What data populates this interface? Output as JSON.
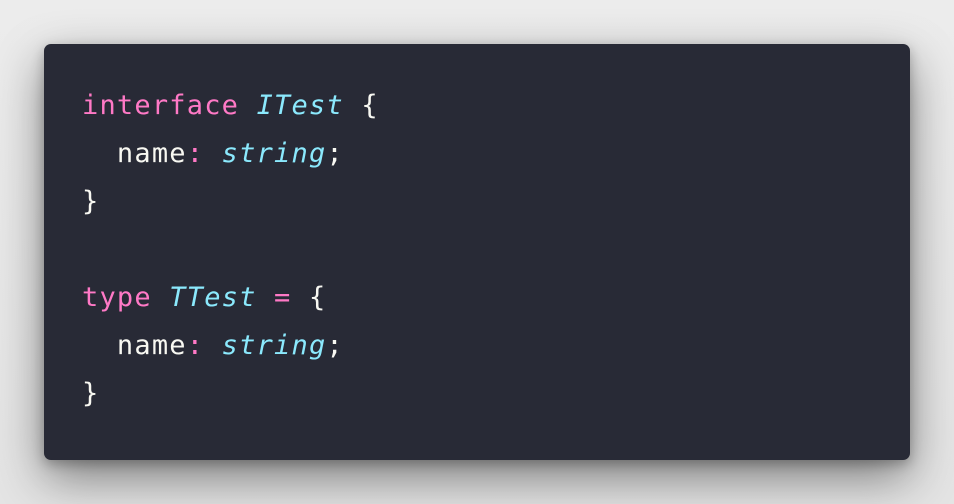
{
  "colors": {
    "background": "#282a36",
    "foreground": "#f8f8f2",
    "keyword": "#ff79c6",
    "type": "#8be9fd"
  },
  "code": {
    "lines": [
      [
        {
          "text": "interface",
          "role": "kw"
        },
        {
          "text": " ",
          "role": "punct"
        },
        {
          "text": "ITest",
          "role": "type"
        },
        {
          "text": " {",
          "role": "punct"
        }
      ],
      [
        {
          "text": "  name",
          "role": "ident"
        },
        {
          "text": ":",
          "role": "op"
        },
        {
          "text": " ",
          "role": "punct"
        },
        {
          "text": "string",
          "role": "type"
        },
        {
          "text": ";",
          "role": "punct"
        }
      ],
      [
        {
          "text": "}",
          "role": "punct"
        }
      ],
      [],
      [
        {
          "text": "type",
          "role": "kw"
        },
        {
          "text": " ",
          "role": "punct"
        },
        {
          "text": "TTest",
          "role": "type"
        },
        {
          "text": " ",
          "role": "punct"
        },
        {
          "text": "=",
          "role": "op"
        },
        {
          "text": " {",
          "role": "punct"
        }
      ],
      [
        {
          "text": "  name",
          "role": "ident"
        },
        {
          "text": ":",
          "role": "op"
        },
        {
          "text": " ",
          "role": "punct"
        },
        {
          "text": "string",
          "role": "type"
        },
        {
          "text": ";",
          "role": "punct"
        }
      ],
      [
        {
          "text": "}",
          "role": "punct"
        }
      ]
    ]
  }
}
